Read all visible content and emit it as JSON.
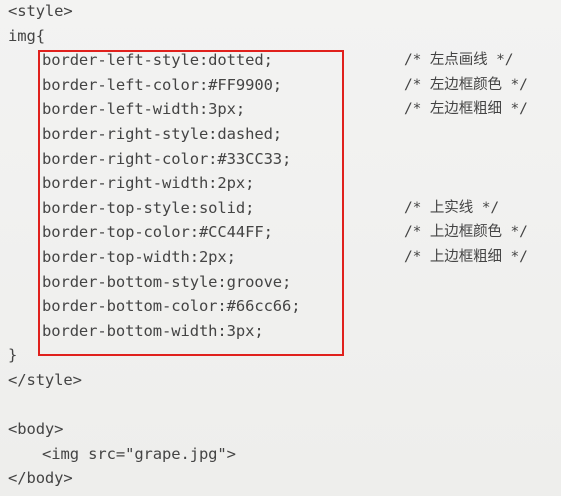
{
  "lines": [
    {
      "indent": 0,
      "code": "<style>",
      "comment": ""
    },
    {
      "indent": 0,
      "code": "img{",
      "comment": ""
    },
    {
      "indent": 1,
      "code": "border-left-style:dotted;",
      "comment": "/* 左点画线 */"
    },
    {
      "indent": 1,
      "code": "border-left-color:#FF9900;",
      "comment": "/* 左边框颜色 */"
    },
    {
      "indent": 1,
      "code": "border-left-width:3px;",
      "comment": "/* 左边框粗细 */"
    },
    {
      "indent": 1,
      "code": "border-right-style:dashed;",
      "comment": ""
    },
    {
      "indent": 1,
      "code": "border-right-color:#33CC33;",
      "comment": ""
    },
    {
      "indent": 1,
      "code": "border-right-width:2px;",
      "comment": ""
    },
    {
      "indent": 1,
      "code": "border-top-style:solid;",
      "comment": "/* 上实线 */"
    },
    {
      "indent": 1,
      "code": "border-top-color:#CC44FF;",
      "comment": "/* 上边框颜色 */"
    },
    {
      "indent": 1,
      "code": "border-top-width:2px;",
      "comment": "/* 上边框粗细 */"
    },
    {
      "indent": 1,
      "code": "border-bottom-style:groove;",
      "comment": ""
    },
    {
      "indent": 1,
      "code": "border-bottom-color:#66cc66;",
      "comment": ""
    },
    {
      "indent": 1,
      "code": "border-bottom-width:3px;",
      "comment": ""
    },
    {
      "indent": 0,
      "code": "}",
      "comment": ""
    },
    {
      "indent": 0,
      "code": "</style>",
      "comment": ""
    },
    {
      "indent": 0,
      "code": "",
      "comment": ""
    },
    {
      "indent": 0,
      "code": "<body>",
      "comment": ""
    },
    {
      "indent": 1,
      "code": "<img src=\"grape.jpg\">",
      "comment": ""
    },
    {
      "indent": 0,
      "code": "</body>",
      "comment": ""
    }
  ],
  "highlight_color": "#e0201c"
}
